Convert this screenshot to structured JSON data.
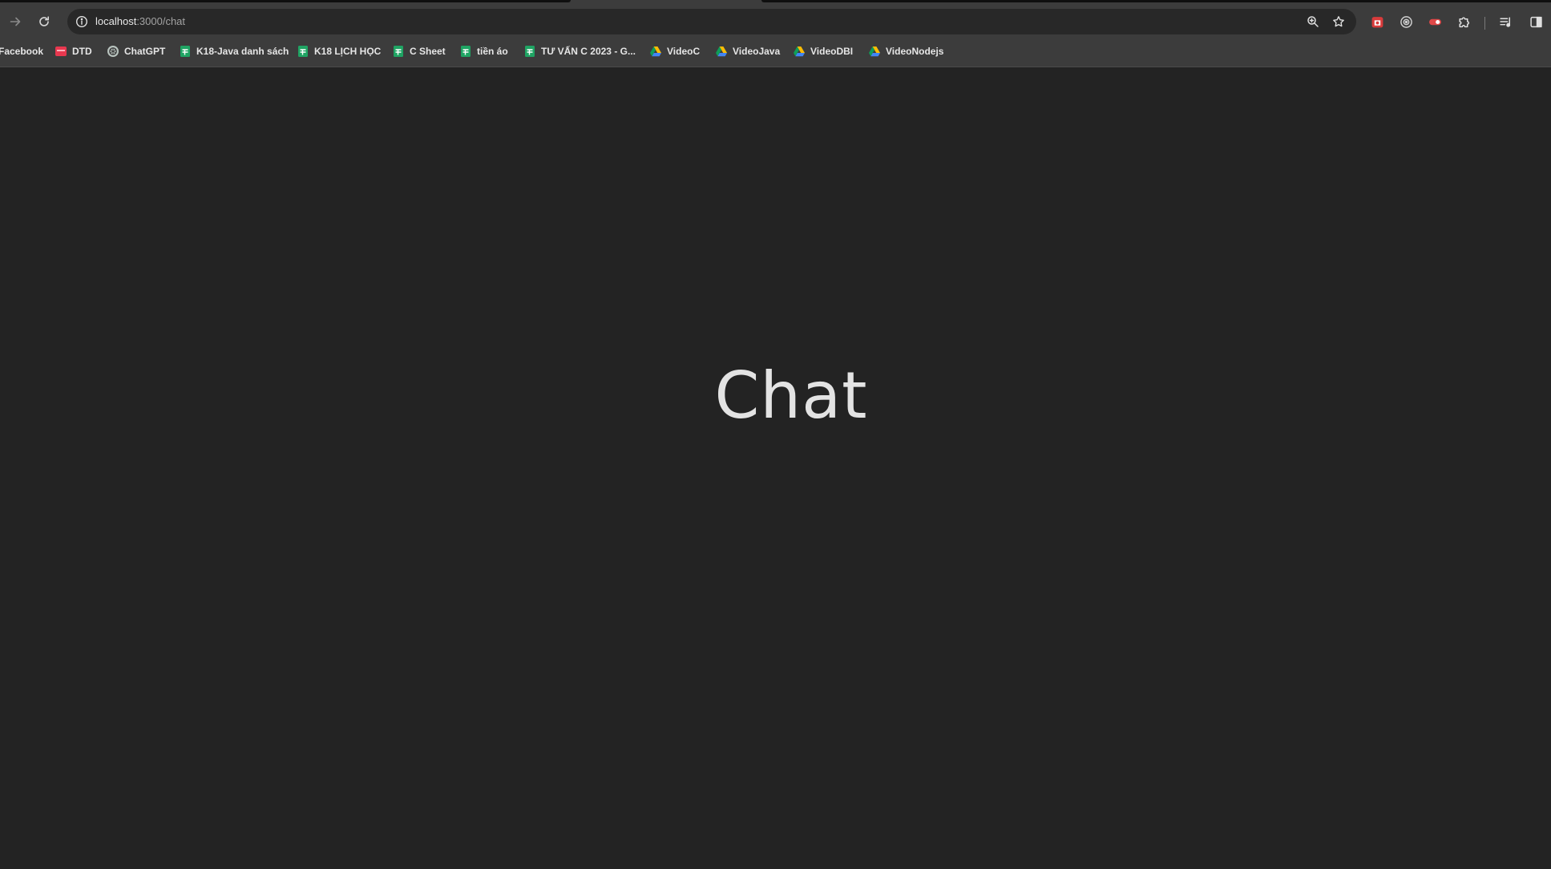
{
  "browser": {
    "url_host": "localhost",
    "url_path": ":3000/chat",
    "colors": {
      "toolbar": "#3c3c3c",
      "omnibox": "#282828",
      "page_background": "#232323",
      "text": "#e6e6e6"
    },
    "icons": {
      "forward": "arrow-right-icon",
      "reload": "reload-icon",
      "site_info": "info-circle-icon",
      "zoom": "zoom-icon",
      "bookmark_star": "star-icon",
      "extensions": [
        "red-extension-icon",
        "target-extension-icon",
        "toggle-extension-icon",
        "puzzle-icon"
      ],
      "media": "media-control-icon",
      "side_panel": "side-panel-icon"
    }
  },
  "bookmarks": [
    {
      "label": "Facebook",
      "icon": "none"
    },
    {
      "label": "DTD",
      "icon": "red-square-icon"
    },
    {
      "label": "ChatGPT",
      "icon": "chatgpt-icon"
    },
    {
      "label": "K18-Java danh sách",
      "icon": "google-sheets-icon"
    },
    {
      "label": "K18 LỊCH HỌC",
      "icon": "google-sheets-icon"
    },
    {
      "label": "C Sheet",
      "icon": "google-sheets-icon"
    },
    {
      "label": "tiền áo",
      "icon": "google-sheets-icon"
    },
    {
      "label": "TƯ VẤN C 2023 - G...",
      "icon": "google-sheets-icon"
    },
    {
      "label": "VideoC",
      "icon": "google-drive-icon"
    },
    {
      "label": "VideoJava",
      "icon": "google-drive-icon"
    },
    {
      "label": "VideoDBI",
      "icon": "google-drive-icon"
    },
    {
      "label": "VideoNodejs",
      "icon": "google-drive-icon"
    }
  ],
  "page": {
    "heading": "Chat"
  }
}
